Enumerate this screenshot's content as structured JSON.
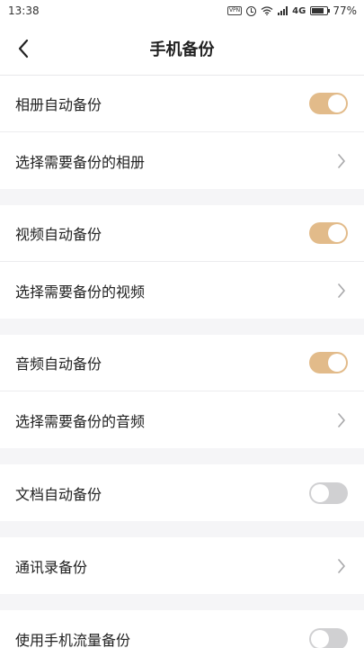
{
  "status_bar": {
    "time": "13:38",
    "vpn": "VPN",
    "network": "4G",
    "battery_percent": "77%",
    "battery_level": 0.77,
    "icons": [
      "vpn-icon",
      "alarm-icon",
      "wifi-icon",
      "signal-icon",
      "battery-icon"
    ]
  },
  "header": {
    "title": "手机备份",
    "back_icon": "back-arrow-icon"
  },
  "colors": {
    "toggle_on": "#e2bb8a",
    "toggle_off": "#d0d0d2",
    "background": "#f5f5f7"
  },
  "groups": [
    {
      "items": [
        {
          "label": "相册自动备份",
          "type": "toggle",
          "on": true
        },
        {
          "label": "选择需要备份的相册",
          "type": "link"
        }
      ]
    },
    {
      "items": [
        {
          "label": "视频自动备份",
          "type": "toggle",
          "on": true
        },
        {
          "label": "选择需要备份的视频",
          "type": "link"
        }
      ]
    },
    {
      "items": [
        {
          "label": "音频自动备份",
          "type": "toggle",
          "on": true
        },
        {
          "label": "选择需要备份的音频",
          "type": "link"
        }
      ]
    },
    {
      "items": [
        {
          "label": "文档自动备份",
          "type": "toggle",
          "on": false
        }
      ]
    },
    {
      "items": [
        {
          "label": "通讯录备份",
          "type": "link"
        }
      ]
    },
    {
      "items": [
        {
          "label": "使用手机流量备份",
          "type": "toggle",
          "on": false
        }
      ]
    }
  ]
}
